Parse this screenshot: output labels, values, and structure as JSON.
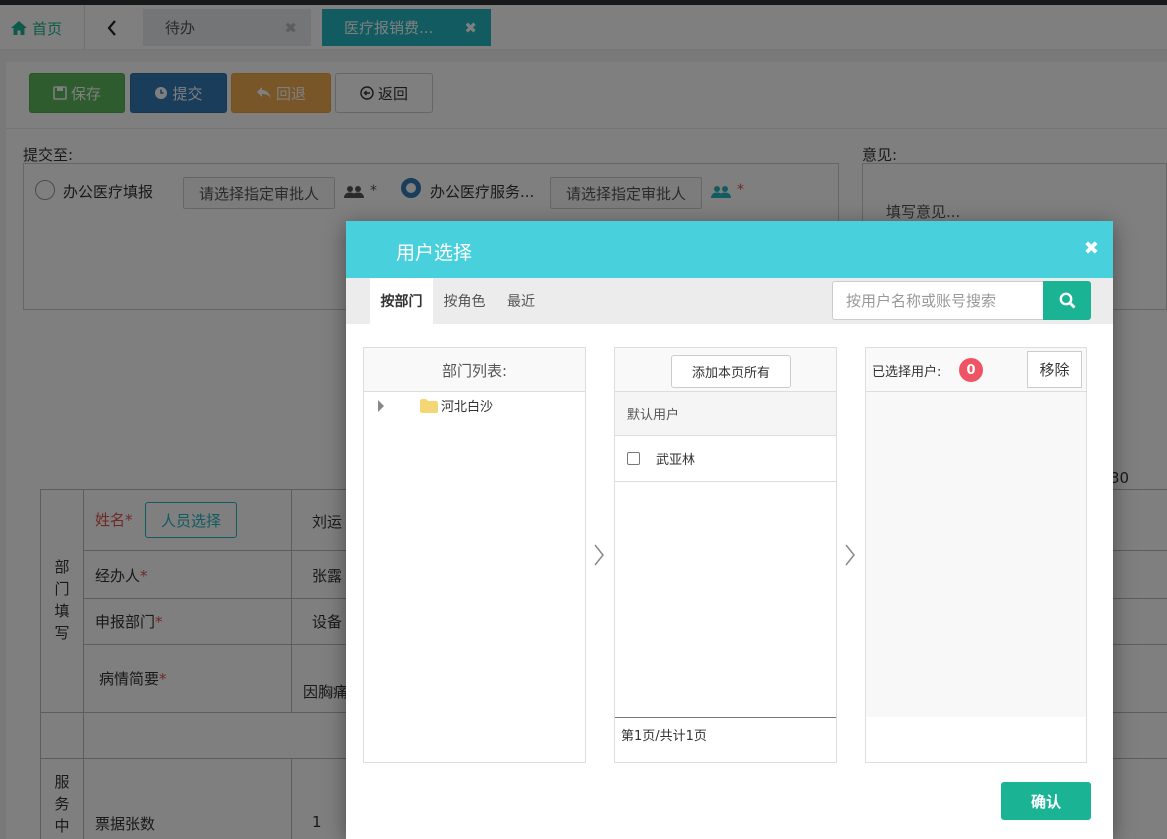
{
  "tabbar": {
    "home_label": "首页",
    "tabs": [
      {
        "label": "待办",
        "close": "✖"
      },
      {
        "label": "医疗报销费...",
        "close": "✖"
      }
    ]
  },
  "toolbar": {
    "save_label": "保存",
    "submit_label": "提交",
    "return_label": "回退",
    "back_label": "返回"
  },
  "submit_section": {
    "label": "提交至:",
    "option1": "办公医疗填报",
    "option2": "办公医疗服务...",
    "approver_placeholder": "请选择指定审批人",
    "required_mark": "*"
  },
  "opinion": {
    "label": "意见:",
    "placeholder": "填写意见..."
  },
  "form": {
    "number_cut": "30",
    "dept_group": [
      "部",
      "门",
      "填",
      "写"
    ],
    "service_group": [
      "服",
      "务",
      "中"
    ],
    "name_label": "姓名",
    "pick_person": "人员选择",
    "name_value": "刘运",
    "handler_label": "经办人",
    "handler_value": "张露",
    "dept_label": "申报部门",
    "dept_value": "设备",
    "illness_label": "病情简要",
    "illness_value": "因胸痛",
    "ticket_label": "票据张数",
    "ticket_value": "1",
    "required_mark": "*"
  },
  "modal": {
    "title": "用户选择",
    "close": "✖",
    "tabs": [
      "按部门",
      "按角色",
      "最近"
    ],
    "search_placeholder": "按用户名称或账号搜索",
    "dept_list_title": "部门列表:",
    "tree_node": "河北白沙",
    "add_all": "添加本页所有",
    "default_users": "默认用户",
    "users": [
      "武亚林"
    ],
    "pager": "第1页/共计1页",
    "selected_label": "已选择用户:",
    "selected_count": "0",
    "remove": "移除",
    "confirm": "确认"
  },
  "colors": {
    "accent": "#48d0dd",
    "green": "#1ab394",
    "badge": "#ed5565"
  }
}
